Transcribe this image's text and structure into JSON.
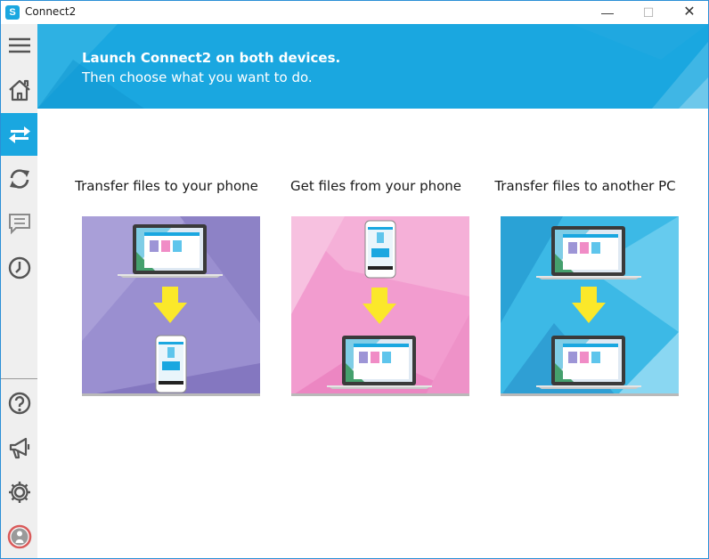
{
  "window": {
    "title": "Connect2",
    "app_icon_glyph": "S",
    "minimize_glyph": "—",
    "maximize_glyph": "☐",
    "close_glyph": "✕"
  },
  "sidebar": {
    "items": [
      {
        "icon": "menu-icon"
      },
      {
        "icon": "home-icon"
      },
      {
        "icon": "transfer-icon",
        "active": true
      },
      {
        "icon": "sync-icon"
      },
      {
        "icon": "message-icon"
      },
      {
        "icon": "history-icon"
      },
      {
        "icon": "help-icon"
      },
      {
        "icon": "megaphone-icon"
      },
      {
        "icon": "settings-icon"
      },
      {
        "icon": "account-icon"
      }
    ]
  },
  "banner": {
    "line1": "Launch Connect2 on both devices.",
    "line2": "Then choose what you want to do."
  },
  "options": [
    {
      "title": "Transfer files to your phone",
      "bg": "#9a8fd0"
    },
    {
      "title": "Get files from your phone",
      "bg": "#f29ccf"
    },
    {
      "title": "Transfer files to another PC",
      "bg": "#3cb9e6"
    }
  ],
  "colors": {
    "accent": "#1aa7e0",
    "arrow": "#fbe82a"
  }
}
